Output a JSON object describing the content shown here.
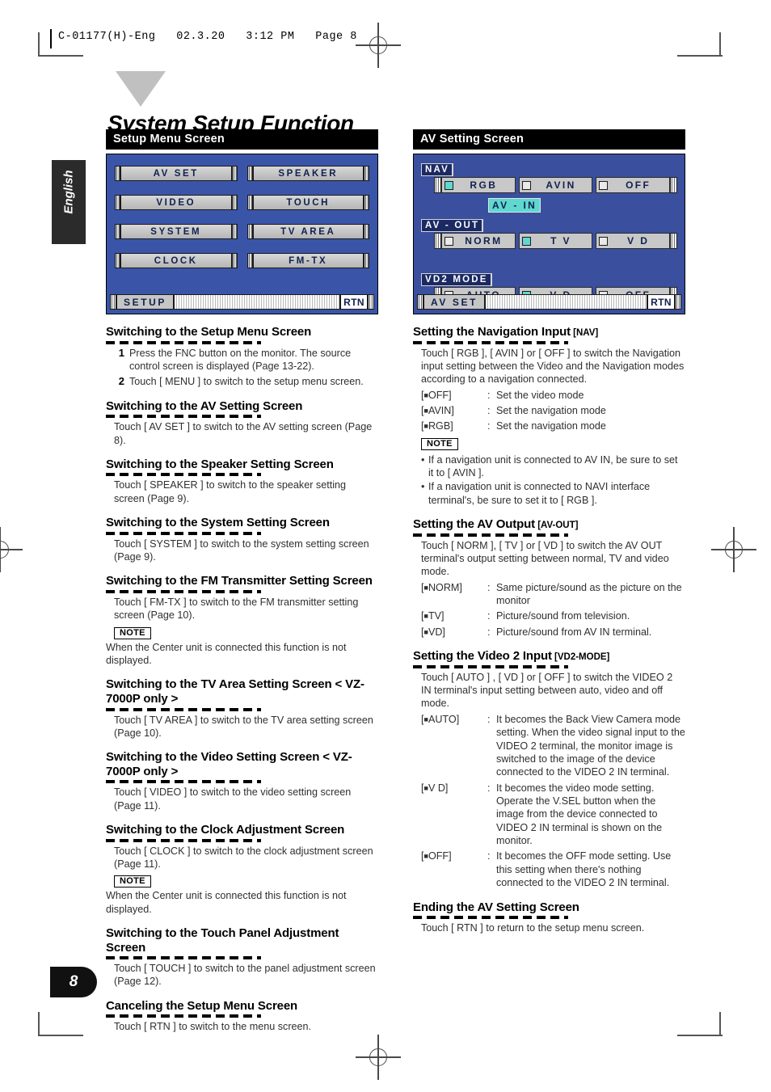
{
  "running_head": "C-01177(H)-Eng   02.3.20   3:12 PM   Page 8",
  "page_title": "System Setup Function",
  "language_tab": "English",
  "page_number": "8",
  "left": {
    "section_bar": "Setup Menu Screen",
    "osd": {
      "buttons": [
        "AV  SET",
        "SPEAKER",
        "VIDEO",
        "TOUCH",
        "SYSTEM",
        "TV  AREA",
        "CLOCK",
        "FM-TX"
      ],
      "bottom_title": "SETUP",
      "bottom_rtn": "RTN"
    },
    "sections": [
      {
        "heading": "Switching to the Setup Menu Screen",
        "steps": [
          {
            "n": "1",
            "text": "Press the FNC button on the monitor. The source control screen is displayed (Page 13-22)."
          },
          {
            "n": "2",
            "text": "Touch [ MENU ] to switch to the setup menu screen."
          }
        ]
      },
      {
        "heading": "Switching to the AV Setting Screen",
        "body": "Touch [ AV SET ] to switch to the AV setting screen (Page 8)."
      },
      {
        "heading": "Switching to the Speaker Setting Screen",
        "body": "Touch [ SPEAKER ] to switch to the speaker setting screen (Page 9)."
      },
      {
        "heading": "Switching to the System Setting Screen",
        "body": "Touch [ SYSTEM ] to switch to the system setting screen (Page 9)."
      },
      {
        "heading": "Switching to the FM Transmitter Setting Screen",
        "body": "Touch [ FM-TX ] to switch to the FM transmitter setting screen (Page 10).",
        "note_label": "NOTE",
        "note_body": "When the Center unit is connected this function is not displayed."
      },
      {
        "heading": "Switching to the TV Area Setting Screen < VZ-7000P only >",
        "body": "Touch [ TV AREA ] to switch to the TV area setting screen (Page 10)."
      },
      {
        "heading": "Switching to the Video Setting Screen < VZ-7000P only >",
        "body": "Touch [ VIDEO ] to switch to the video setting screen (Page 11)."
      },
      {
        "heading": "Switching to the Clock Adjustment Screen",
        "body": "Touch [ CLOCK ] to switch to the clock adjustment screen (Page 11).",
        "note_label": "NOTE",
        "note_body": "When the Center unit is connected this function is not displayed."
      },
      {
        "heading": "Switching to the Touch Panel Adjustment Screen",
        "body": "Touch [ TOUCH ] to switch to the panel adjustment screen (Page 12)."
      },
      {
        "heading": "Canceling the Setup Menu Screen",
        "body": "Touch [ RTN ] to switch to the menu screen."
      }
    ]
  },
  "right": {
    "section_bar": "AV Setting Screen",
    "osd": {
      "nav_label": "NAV",
      "nav_options": [
        {
          "label": "RGB",
          "selected": true
        },
        {
          "label": "AVIN",
          "selected": false
        },
        {
          "label": "OFF",
          "selected": false
        }
      ],
      "avin_chip": "AV - IN",
      "avout_label": "AV - OUT",
      "avout_options": [
        {
          "label": "NORM",
          "selected": false
        },
        {
          "label": "T  V",
          "selected": true
        },
        {
          "label": "V  D",
          "selected": false
        }
      ],
      "vd2_label": "VD2  MODE",
      "vd2_options": [
        {
          "label": "AUTO",
          "selected": false
        },
        {
          "label": "V  D",
          "selected": true
        },
        {
          "label": "OFF",
          "selected": false
        }
      ],
      "bottom_title": "AV  SET",
      "bottom_rtn": "RTN"
    },
    "sections": [
      {
        "heading": "Setting the Navigation Input",
        "tag": "[NAV]",
        "body": "Touch [ RGB ], [ AVIN ] or [ OFF ] to switch the Navigation input setting between the Video and the Navigation modes according to a navigation connected.",
        "defs": [
          {
            "key": "[■OFF]",
            "desc": "Set the video mode"
          },
          {
            "key": "[■AVIN]",
            "desc": "Set the navigation mode"
          },
          {
            "key": "[■RGB]",
            "desc": "Set the navigation mode"
          }
        ],
        "note_label": "NOTE",
        "bullets": [
          "If a navigation unit is connected to AV IN, be sure to set it to [ AVIN ].",
          "If a navigation unit is connected to NAVI interface terminal's, be sure to set it to [ RGB ]."
        ]
      },
      {
        "heading": "Setting the AV Output",
        "tag": "[AV-OUT]",
        "body": "Touch [ NORM ], [ TV ] or [ VD ] to switch the AV OUT terminal's output setting between normal, TV and video mode.",
        "defs": [
          {
            "key": "[■NORM]",
            "desc": "Same picture/sound as the picture on the monitor"
          },
          {
            "key": "[■TV]",
            "desc": "Picture/sound from television."
          },
          {
            "key": "[■VD]",
            "desc": "Picture/sound from AV IN terminal."
          }
        ]
      },
      {
        "heading": "Setting the Video 2 Input",
        "tag": "[VD2-MODE]",
        "body": "Touch [ AUTO ] , [ VD ]  or [ OFF ] to switch the VIDEO 2 IN  terminal's input setting between auto, video and off mode.",
        "defs": [
          {
            "key": "[■AUTO]",
            "desc": "It becomes the Back View Camera mode setting. When the video signal input to the VIDEO 2 terminal, the monitor image is switched to the image of the device connected to the VIDEO 2 IN terminal."
          },
          {
            "key": "[■V D]",
            "desc": "It becomes the video mode setting. Operate the V.SEL button when the image from the device connected to VIDEO 2 IN terminal is shown on the monitor."
          },
          {
            "key": "[■OFF]",
            "desc": "It becomes the OFF mode setting. Use this setting when there's nothing connected to the VIDEO 2 IN terminal."
          }
        ]
      },
      {
        "heading": "Ending the AV Setting Screen",
        "body": "Touch [ RTN ] to return to the setup menu screen."
      }
    ]
  }
}
